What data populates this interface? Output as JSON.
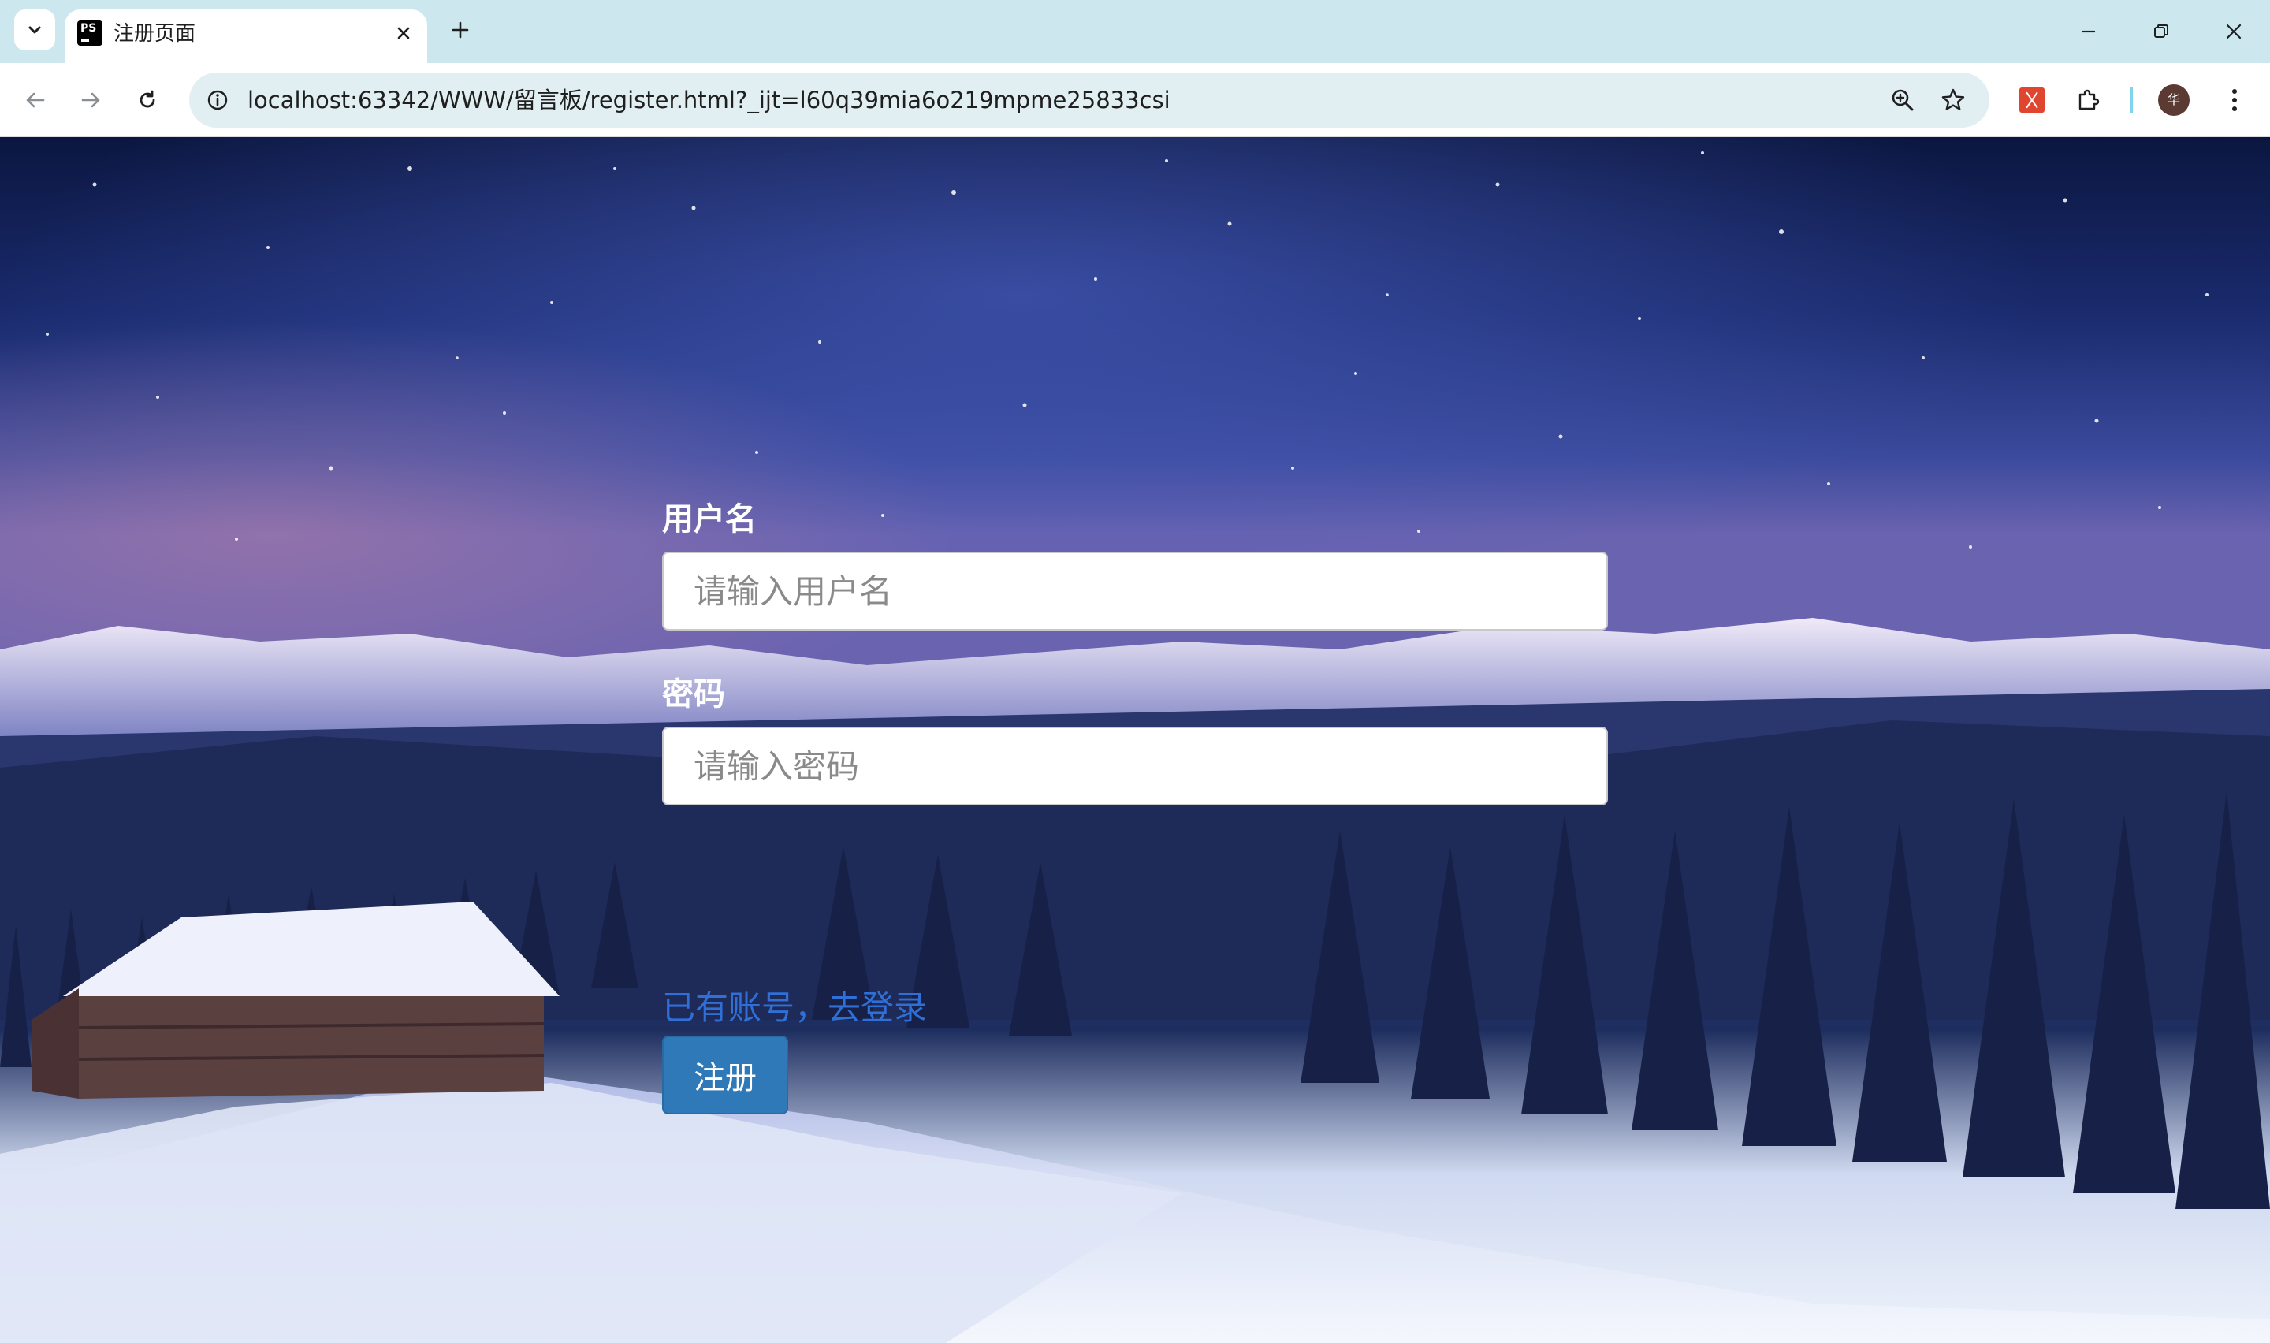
{
  "browser": {
    "tab_title": "注册页面",
    "favicon_text": "PS",
    "url": "localhost:63342/WWW/留言板/register.html?_ijt=l60q39mia6o219mpme25833csi",
    "avatar_text": "华"
  },
  "form": {
    "username_label": "用户名",
    "username_placeholder": "请输入用户名",
    "password_label": "密码",
    "password_placeholder": "请输入密码",
    "login_link": "已有账号，去登录",
    "register_button": "注册"
  },
  "colors": {
    "accent_button": "#2f79b8",
    "link": "#2f6fd6"
  }
}
